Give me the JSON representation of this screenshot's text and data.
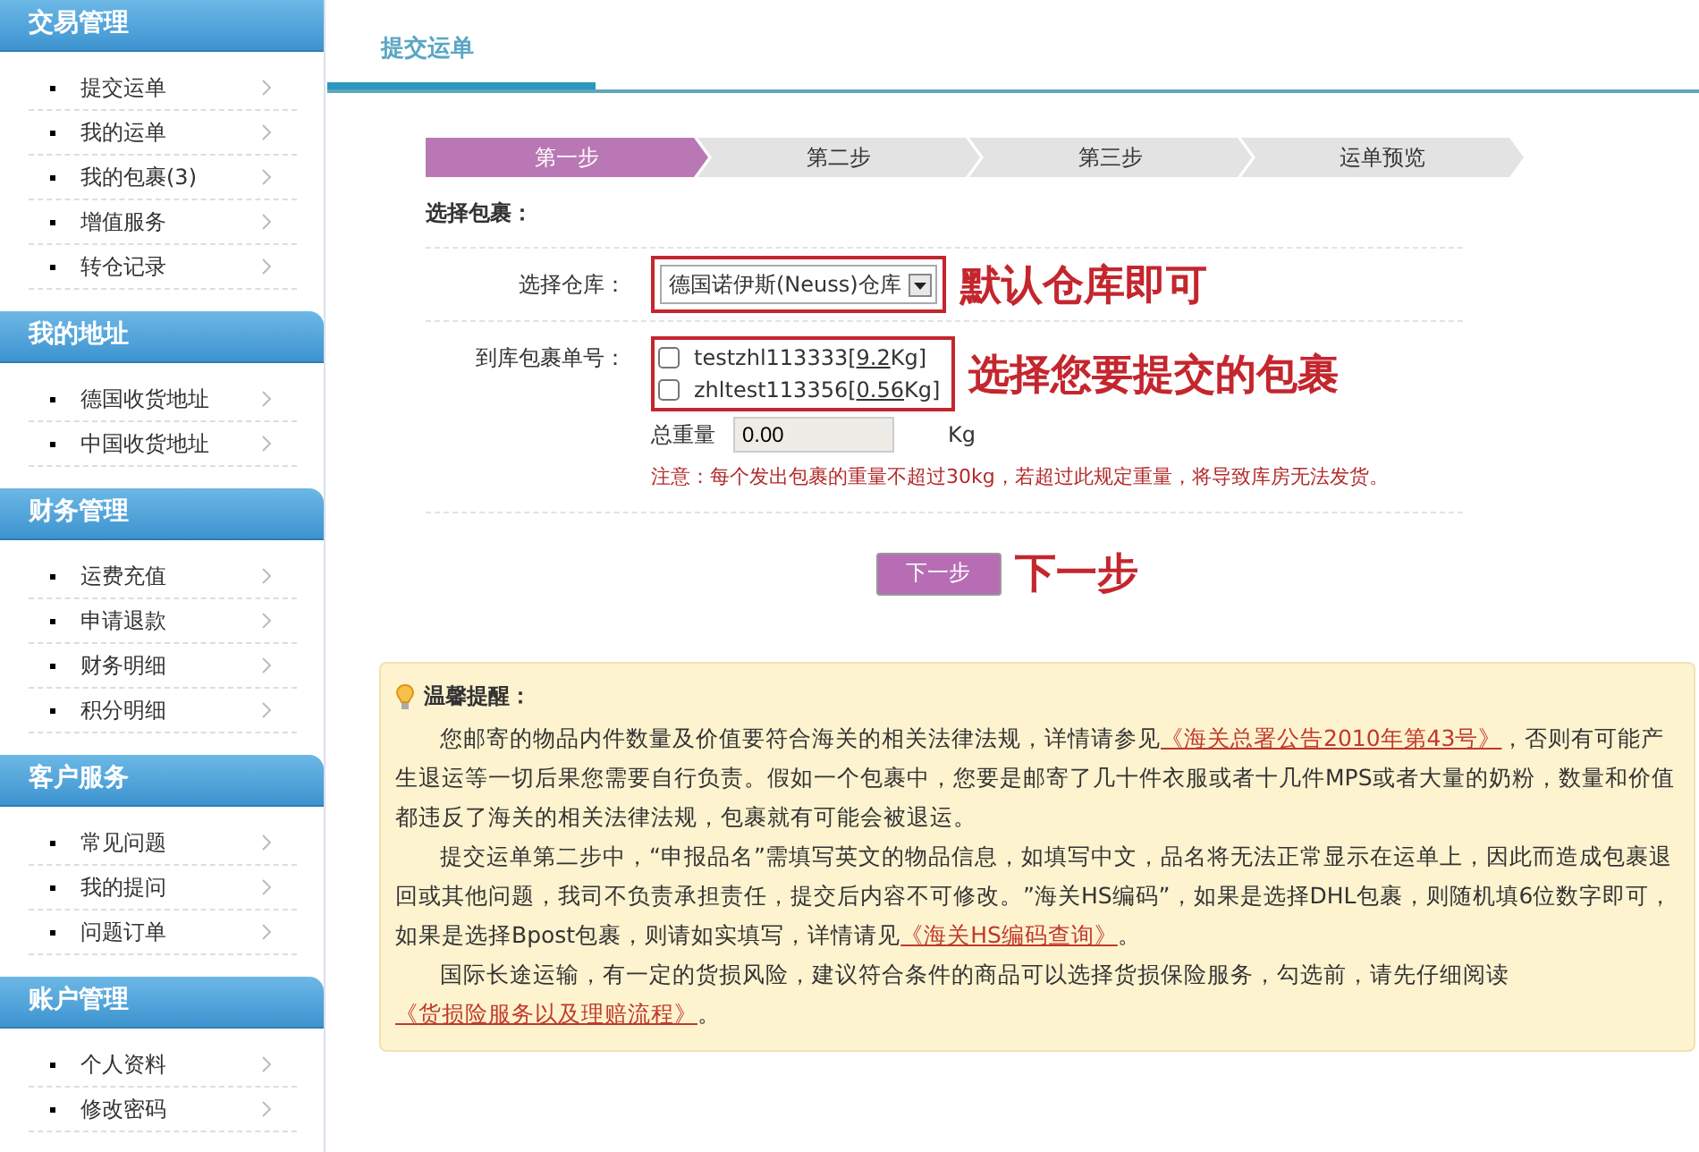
{
  "sidebar": [
    {
      "title": "交易管理",
      "items": [
        "提交运单",
        "我的运单",
        "我的包裹(3)",
        "增值服务",
        "转仓记录"
      ]
    },
    {
      "title": "我的地址",
      "items": [
        "德国收货地址",
        "中国收货地址"
      ]
    },
    {
      "title": "财务管理",
      "items": [
        "运费充值",
        "申请退款",
        "财务明细",
        "积分明细"
      ]
    },
    {
      "title": "客户服务",
      "items": [
        "常见问题",
        "我的提问",
        "问题订单"
      ]
    },
    {
      "title": "账户管理",
      "items": [
        "个人资料",
        "修改密码"
      ]
    }
  ],
  "tab": {
    "label": "提交运单"
  },
  "steps": [
    {
      "label": "第一步",
      "selected": true
    },
    {
      "label": "第二步",
      "selected": false
    },
    {
      "label": "第三步",
      "selected": false
    },
    {
      "label": "运单预览",
      "selected": false
    }
  ],
  "form": {
    "heading": "选择包裹：",
    "warehouse": {
      "label": "选择仓库：",
      "value": "德国诺伊斯(Neuss)仓库",
      "annotation": "默认仓库即可"
    },
    "packages": {
      "label": "到库包裹单号：",
      "annotation": "选择您要提交的包裹",
      "items": [
        {
          "prefix": "testzhl113333[",
          "weight": "9.2",
          "suffix": "Kg]",
          "checked": false
        },
        {
          "prefix": "zhltest113356[",
          "weight": "0.56",
          "suffix": "Kg]",
          "checked": false
        }
      ]
    },
    "total": {
      "label": "总重量",
      "value": "0.00",
      "unit": "Kg"
    },
    "warning": "注意：每个发出包裹的重量不超过30kg，若超过此规定重量，将导致库房无法发货。"
  },
  "next": {
    "label": "下一步",
    "annotation": "下一步"
  },
  "notice": {
    "title": "温馨提醒：",
    "paragraphs": [
      [
        {
          "kind": "text",
          "text": "您邮寄的物品内件数量及价值要符合海关的相关法律法规，详情请参见"
        },
        {
          "kind": "link",
          "text": "《海关总署公告2010年第43号》"
        },
        {
          "kind": "text",
          "text": "，否则有可能产生退运等一切后果您需要自行负责。假如一个包裹中，您要是邮寄了几十件衣服或者十几件MPS或者大量的奶粉，数量和价值都违反了海关的相关法律法规，包裹就有可能会被退运。"
        }
      ],
      [
        {
          "kind": "text",
          "text": "提交运单第二步中，“申报品名”需填写英文的物品信息，如填写中文，品名将无法正常显示在运单上，因此而造成包裹退回或其他问题，我司不负责承担责任，提交后内容不可修改。”海关HS编码”，如果是选择DHL包裹，则随机填6位数字即可，如果是选择Bpost包裹，则请如实填写，详情请见"
        },
        {
          "kind": "link",
          "text": "《海关HS编码查询》"
        },
        {
          "kind": "text",
          "text": "。"
        }
      ],
      [
        {
          "kind": "text",
          "text": "国际长途运输，有一定的货损风险，建议符合条件的商品可以选择货损保险服务，勾选前，请先仔细阅读"
        },
        {
          "kind": "link",
          "text": "《货损险服务以及理赔流程》"
        },
        {
          "kind": "text",
          "text": "。"
        }
      ]
    ]
  }
}
